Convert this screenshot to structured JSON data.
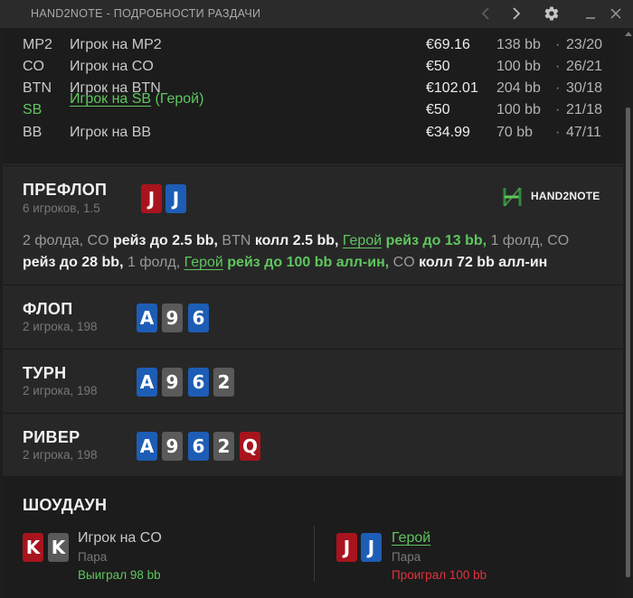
{
  "window": {
    "title": "HAND2NOTE - ПОДРОБНОСТИ РАЗДАЧИ"
  },
  "players": [
    {
      "pos": "MP2",
      "name": "Игрок на MP2",
      "stack": "€69.16",
      "bb": "138 bb",
      "stat": "23/20",
      "hero": false
    },
    {
      "pos": "CO",
      "name": "Игрок на CO",
      "stack": "€50",
      "bb": "100 bb",
      "stat": "26/21",
      "hero": false
    },
    {
      "pos": "BTN",
      "name": "Игрок на BTN",
      "stack": "€102.01",
      "bb": "204 bb",
      "stat": "30/18",
      "hero": false
    },
    {
      "pos": "SB",
      "name": "Игрок на SB",
      "hero_tag": " (Герой)",
      "stack": "€50",
      "bb": "100 bb",
      "stat": "21/18",
      "hero": true
    },
    {
      "pos": "BB",
      "name": "Игрок на BB",
      "stack": "€34.99",
      "bb": "70 bb",
      "stat": "47/11",
      "hero": false
    }
  ],
  "stat_separator": "·",
  "logo": {
    "text": "HAND2NOTE"
  },
  "streets": {
    "preflop": {
      "title": "ПРЕФЛОП",
      "sub": "6 игроков, 1.5",
      "cards": [
        {
          "rank": "J",
          "color": "red"
        },
        {
          "rank": "J",
          "color": "blue"
        }
      ],
      "actions": {
        "a1": "2 фолда, CO",
        "a2": "рейз до 2.5 bb,",
        "a3": "BTN",
        "a4": "колл 2.5 bb,",
        "a5": "Герой",
        "a6": "рейз до 13 bb,",
        "a7": "1 фолд, CO",
        "a8": "рейз до 28 bb,",
        "a9": "1 фолд,",
        "a10": "Герой",
        "a11": "рейз до 100 bb алл-ин,",
        "a12": "CO",
        "a13": "колл 72 bb алл-ин"
      }
    },
    "flop": {
      "title": "ФЛОП",
      "sub": "2 игрока, 198",
      "cards": [
        {
          "rank": "A",
          "color": "blue"
        },
        {
          "rank": "9",
          "color": "grey"
        },
        {
          "rank": "6",
          "color": "blue"
        }
      ]
    },
    "turn": {
      "title": "ТУРН",
      "sub": "2 игрока, 198",
      "cards": [
        {
          "rank": "A",
          "color": "blue"
        },
        {
          "rank": "9",
          "color": "grey"
        },
        {
          "rank": "6",
          "color": "blue"
        },
        {
          "rank": "2",
          "color": "grey"
        }
      ]
    },
    "river": {
      "title": "РИВЕР",
      "sub": "2 игрока, 198",
      "cards": [
        {
          "rank": "A",
          "color": "blue"
        },
        {
          "rank": "9",
          "color": "grey"
        },
        {
          "rank": "6",
          "color": "blue"
        },
        {
          "rank": "2",
          "color": "grey"
        },
        {
          "rank": "Q",
          "color": "red"
        }
      ]
    }
  },
  "showdown": {
    "title": "ШОУДАУН",
    "left": {
      "name": "Игрок на CO",
      "hand": "Пара",
      "result": "Выиграл 98 bb",
      "cards": [
        {
          "rank": "K",
          "color": "red"
        },
        {
          "rank": "K",
          "color": "grey"
        }
      ]
    },
    "right": {
      "name": "Герой",
      "hand": "Пара",
      "result": "Проиграл 100 bb",
      "cards": [
        {
          "rank": "J",
          "color": "red"
        },
        {
          "rank": "J",
          "color": "blue"
        }
      ]
    }
  },
  "colors": {
    "hero_green": "#5ec65e",
    "card_red": "#a8141e",
    "card_blue": "#1d5db5",
    "card_grey": "#5a5a5a",
    "loss_red": "#e0323c"
  }
}
